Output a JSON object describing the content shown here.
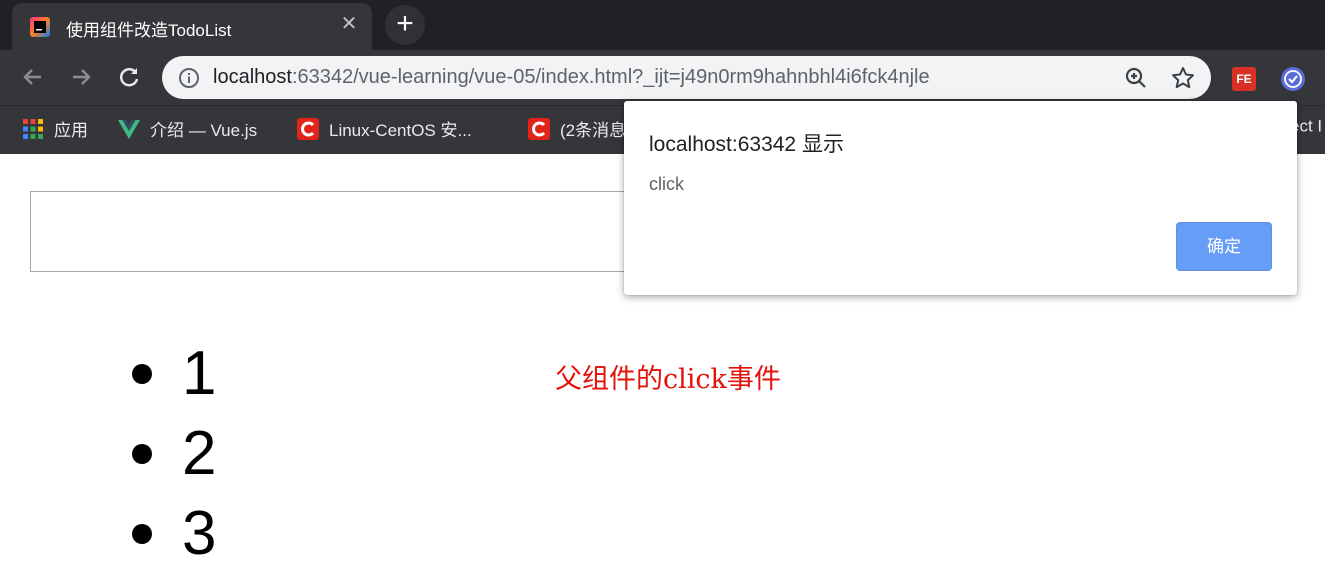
{
  "tab": {
    "favicon": "jetbrains-icon",
    "title": "使用组件改造TodoList",
    "close_icon": "close-icon"
  },
  "toolbar": {
    "url_host": "localhost",
    "url_rest": ":63342/vue-learning/vue-05/index.html?_ijt=j49n0rm9hahnbhl4i6fck4njle",
    "extensions": [
      "fe-helper-icon",
      "checkmark-extension-icon"
    ]
  },
  "bookmarks": [
    {
      "icon": "apps-grid-icon",
      "label": "应用"
    },
    {
      "icon": "vue-logo-icon",
      "label": "介绍 — Vue.js"
    },
    {
      "icon": "csdn-icon",
      "label": "Linux-CentOS 安..."
    },
    {
      "icon": "csdn-icon",
      "label": "(2条消息"
    },
    {
      "icon": "",
      "label": "ect I"
    }
  ],
  "page": {
    "input_value": "",
    "items": [
      "1",
      "2",
      "3"
    ],
    "parent_note": "父组件的click事件"
  },
  "dialog": {
    "title": "localhost:63342 显示",
    "message": "click",
    "ok_label": "确定",
    "button_color": "#669df6"
  }
}
